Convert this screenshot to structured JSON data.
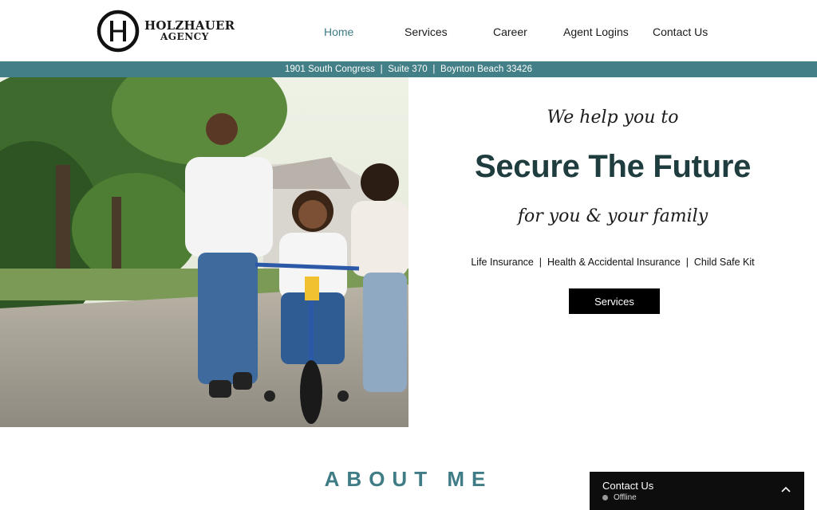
{
  "header": {
    "logo_line1": "HOLZHAUER",
    "logo_line2": "AGENCY",
    "logo_monogram": "H"
  },
  "nav": [
    {
      "label": "Home",
      "active": true
    },
    {
      "label": "Services",
      "active": false
    },
    {
      "label": "Career",
      "active": false
    },
    {
      "label": "Agent Logins",
      "active": false
    },
    {
      "label": "Contact Us",
      "active": false
    }
  ],
  "address": "1901 South Congress  |  Suite 370  |  Boynton Beach 33426",
  "hero": {
    "tagline_top": "We help you to",
    "headline": "Secure The Future",
    "tagline_bottom": "for you & your family",
    "products": "Life Insurance  |  Health & Accidental Insurance  |  Child Safe Kit",
    "cta_label": "Services"
  },
  "about": {
    "heading": "ABOUT ME"
  },
  "chat": {
    "title": "Contact Us",
    "status": "Offline"
  },
  "colors": {
    "accent": "#437f86",
    "headline": "#1f3d3f",
    "nav_active": "#3f7c86",
    "button": "#000000",
    "chat_bg": "#0d0d0d"
  },
  "icons": {
    "logo": "h-monogram-logo",
    "chat_toggle": "chevron-up-icon",
    "chat_status": "status-dot-icon"
  }
}
